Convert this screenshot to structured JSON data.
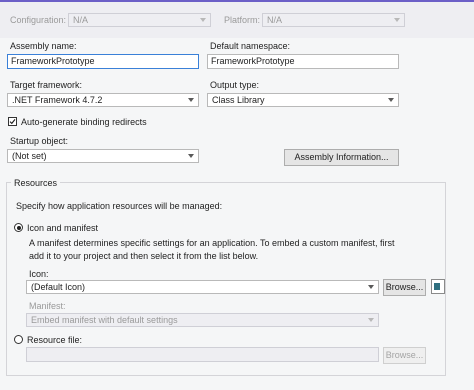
{
  "header": {
    "configuration_label": "Configuration:",
    "configuration_value": "N/A",
    "platform_label": "Platform:",
    "platform_value": "N/A"
  },
  "assembly": {
    "name_label": "Assembly name:",
    "name_value": "FrameworkPrototype",
    "namespace_label": "Default namespace:",
    "namespace_value": "FrameworkPrototype"
  },
  "framework": {
    "target_label": "Target framework:",
    "target_value": ".NET Framework 4.7.2",
    "output_label": "Output type:",
    "output_value": "Class Library"
  },
  "binding_redirects": {
    "label": "Auto-generate binding redirects",
    "checked": true
  },
  "startup": {
    "label": "Startup object:",
    "value": "(Not set)",
    "assembly_info_button": "Assembly Information..."
  },
  "resources": {
    "group_title": "Resources",
    "description": "Specify how application resources will be managed:",
    "icon_manifest_radio": "Icon and manifest",
    "icon_manifest_selected": true,
    "manifest_help_line1": "A manifest determines specific settings for an application. To embed a custom manifest, first",
    "manifest_help_line2": "add it to your project and then select it from the list below.",
    "icon_label": "Icon:",
    "icon_value": "(Default Icon)",
    "browse_button": "Browse...",
    "manifest_label": "Manifest:",
    "manifest_value": "Embed manifest with default settings",
    "resource_file_radio": "Resource file:",
    "resource_file_value": "",
    "browse_disabled_button": "Browse..."
  },
  "colors": {
    "accent_focus_border": "#3a80d8",
    "title_strip_line": "#6c5fc7"
  }
}
